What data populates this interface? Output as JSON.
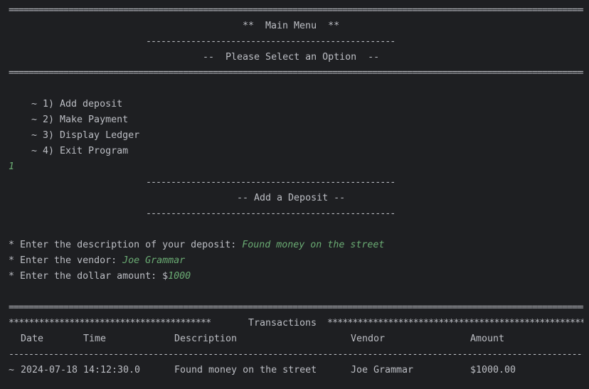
{
  "rules": {
    "double": "=====================================================================================================================================================================================================",
    "single_short": "--------------------------------------------------",
    "single_long": "-----------------------------------------------------------------------------------------------------------------------------------------------------------------------------------------------------------"
  },
  "menu": {
    "title": "**  Main Menu  **",
    "subtitle": "--  Please Select an Option  --",
    "options": [
      "~ 1) Add deposit",
      "~ 2) Make Payment",
      "~ 3) Display Ledger",
      "~ 4) Exit Program"
    ],
    "user_choice": "1"
  },
  "deposit": {
    "title": "-- Add a Deposit --",
    "prompts": {
      "description": "* Enter the description of your deposit: ",
      "vendor": "* Enter the vendor: ",
      "amount": "* Enter the dollar amount: $"
    },
    "inputs": {
      "description": "Found money on the street",
      "vendor": "Joe Grammar",
      "amount": "1000"
    }
  },
  "transactions": {
    "stars_left": "****************************************",
    "title": "Transactions",
    "stars_right": "*****************************************************",
    "headers": {
      "date": "Date",
      "time": "Time",
      "description": "Description",
      "vendor": "Vendor",
      "amount": "Amount"
    },
    "rows": [
      {
        "prefix": "~",
        "date": "2024-07-18",
        "time": "14:12:30.0",
        "description": "Found money on the street",
        "vendor": "Joe Grammar",
        "amount": "$1000.00"
      }
    ]
  },
  "colors": {
    "background": "#1e1f22",
    "text": "#bcbec4",
    "user_input": "#6aab73"
  }
}
